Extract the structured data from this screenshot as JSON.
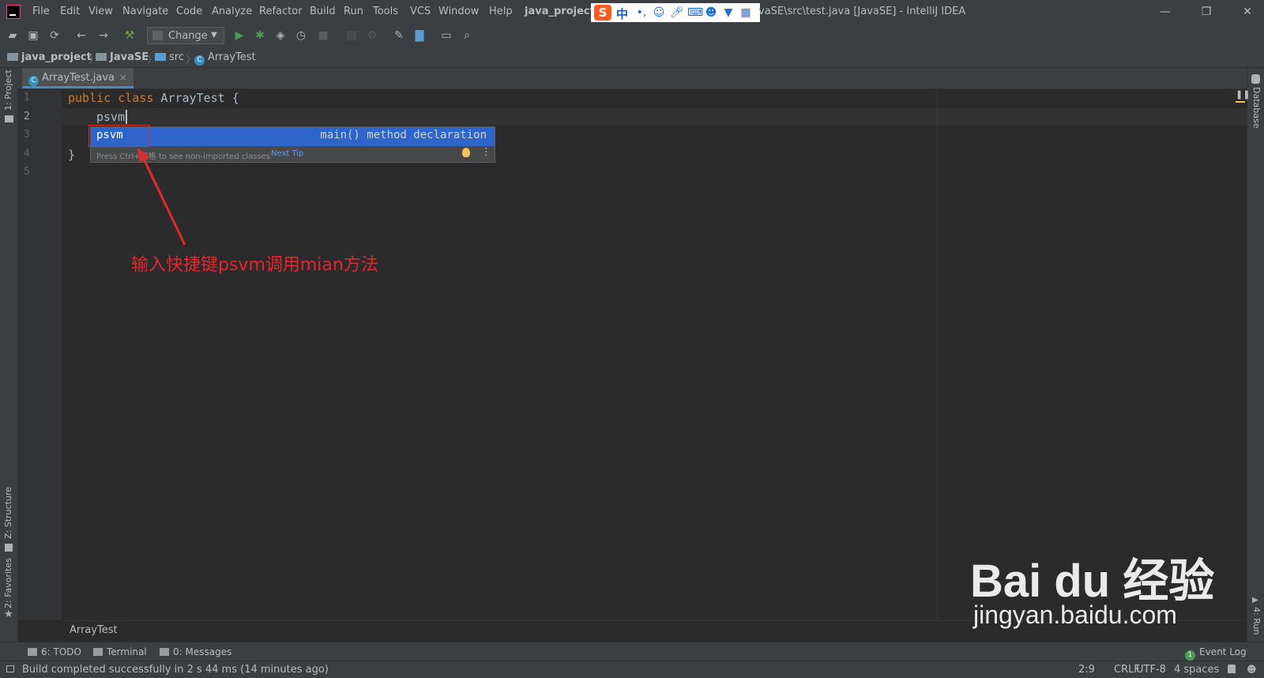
{
  "menu": [
    "File",
    "Edit",
    "View",
    "Navigate",
    "Code",
    "Analyze",
    "Refactor",
    "Build",
    "Run",
    "Tools",
    "VCS",
    "Window",
    "Help"
  ],
  "window": {
    "project": "java_project",
    "path": "vaSE\\src\\test.java [JavaSE] - IntelliJ IDEA",
    "controls": {
      "minimize": "—",
      "restore": "❐",
      "close": "✕"
    }
  },
  "ime": {
    "logo": "S",
    "mode": "中",
    "punct": "•,"
  },
  "toolbar": {
    "run_config": "Change"
  },
  "breadcrumbs": [
    "java_project",
    "JavaSE",
    "src",
    "ArrayTest"
  ],
  "left_tools": {
    "project": "1: Project",
    "structure": "Z: Structure",
    "favorites": "2: Favorites"
  },
  "right_tools": {
    "database": "Database",
    "run": "4: Run"
  },
  "tab": {
    "label": "ArrayTest.java",
    "close": "×"
  },
  "editor": {
    "line_numbers": [
      "1",
      "2",
      "3",
      "4",
      "5"
    ],
    "line1_kw1": "public",
    "line1_kw2": "class",
    "line1_name": "ArrayTest",
    "line1_brace": "{",
    "line2": "psvm",
    "line4": "}"
  },
  "completion": {
    "item": "psvm",
    "description": "main() method declaration",
    "hint": "Press Ctrl+空格 to see non-imported classes",
    "next_tip": "Next Tip",
    "more": "⋮"
  },
  "annotation": "输入快捷键psvm调用mian方法",
  "editor_breadcrumb": "ArrayTest",
  "bottom_tools": {
    "todo": "6: TODO",
    "terminal": "Terminal",
    "messages": "0: Messages",
    "event_log_count": "1",
    "event_log": "Event Log"
  },
  "status": {
    "message": "Build completed successfully in 2 s 44 ms (14 minutes ago)",
    "position": "2:9",
    "line_sep": "CRLF",
    "encoding": "UTF-8",
    "indent": "4 spaces"
  },
  "watermark": {
    "logo": "Bai du 经验",
    "url": "jingyan.baidu.com"
  },
  "colors": {
    "background": "#2b2b2b",
    "keyword": "#cc7832",
    "selection": "#2f65ca",
    "annotation": "#e8242c"
  }
}
